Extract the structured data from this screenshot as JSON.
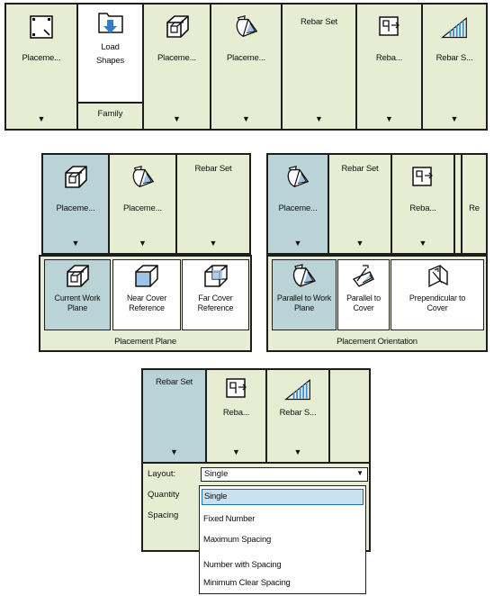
{
  "ribbon1": {
    "tools": [
      {
        "label": "Placeme...",
        "icon": "rebar-shape-square-icon"
      },
      {
        "label": "Load Shapes",
        "icon": "load-shapes-folder-icon",
        "group": "Family"
      },
      {
        "label": "Placeme...",
        "icon": "current-work-plane-cube-icon"
      },
      {
        "label": "Placeme...",
        "icon": "parallel-to-work-plane-icon"
      },
      {
        "label": "Rebar Set",
        "icon": ""
      },
      {
        "label": "Reba...",
        "icon": "rebar-layout-icon"
      },
      {
        "label": "Rebar S...",
        "icon": "rebar-spacing-icon"
      }
    ],
    "arrow": "▼"
  },
  "ribbon2": {
    "tools": [
      {
        "label": "Placeme..."
      },
      {
        "label": "Placeme..."
      },
      {
        "label": "Rebar Set"
      }
    ],
    "flyout": {
      "items": [
        {
          "label": "Current Work Plane"
        },
        {
          "label": "Near Cover Reference"
        },
        {
          "label": "Far Cover Reference"
        }
      ],
      "caption": "Placement Plane"
    }
  },
  "ribbon3": {
    "tools": [
      {
        "label": "Placeme..."
      },
      {
        "label": "Rebar Set"
      },
      {
        "label": "Reba..."
      },
      {
        "label": "Re"
      }
    ],
    "flyout": {
      "items": [
        {
          "label": "Parallel to Work Plane"
        },
        {
          "label": "Parallel to Cover"
        },
        {
          "label": "Prependicular to Cover"
        }
      ],
      "caption": "Placement Orientation"
    }
  },
  "ribbon4": {
    "tools": [
      {
        "label": "Rebar Set"
      },
      {
        "label": "Reba..."
      },
      {
        "label": "Rebar S..."
      }
    ],
    "fields": {
      "layout_label": "Layout:",
      "layout_value": "Single",
      "quantity_label": "Quantity",
      "spacing_label": "Spacing"
    },
    "dropdown_options": [
      "Single",
      "Fixed Number",
      "Maximum Spacing",
      "Number with Spacing",
      "Minimum Clear Spacing"
    ]
  }
}
